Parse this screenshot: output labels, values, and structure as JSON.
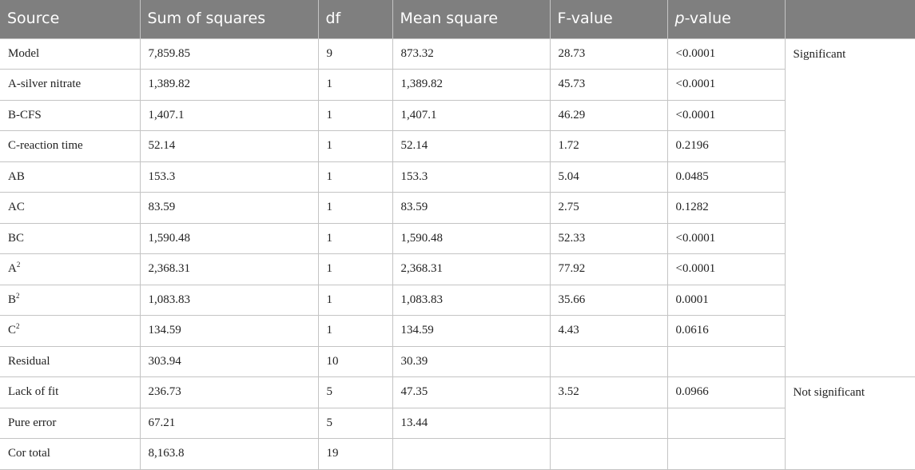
{
  "table": {
    "headers": {
      "source": "Source",
      "sum_of_squares": "Sum of squares",
      "df": "df",
      "mean_square": "Mean square",
      "f_value": "F-value",
      "p_prefix": "p",
      "p_suffix": "-value",
      "significance": ""
    },
    "rows": [
      {
        "source": "Model",
        "sup": "",
        "ss": "7,859.85",
        "df": "9",
        "ms": "873.32",
        "f": "28.73",
        "p": "<0.0001"
      },
      {
        "source": "A-silver nitrate",
        "sup": "",
        "ss": "1,389.82",
        "df": "1",
        "ms": "1,389.82",
        "f": "45.73",
        "p": "<0.0001"
      },
      {
        "source": "B-CFS",
        "sup": "",
        "ss": "1,407.1",
        "df": "1",
        "ms": "1,407.1",
        "f": "46.29",
        "p": "<0.0001"
      },
      {
        "source": "C-reaction time",
        "sup": "",
        "ss": "52.14",
        "df": "1",
        "ms": "52.14",
        "f": "1.72",
        "p": "0.2196"
      },
      {
        "source": "AB",
        "sup": "",
        "ss": "153.3",
        "df": "1",
        "ms": "153.3",
        "f": "5.04",
        "p": "0.0485"
      },
      {
        "source": "AC",
        "sup": "",
        "ss": "83.59",
        "df": "1",
        "ms": "83.59",
        "f": "2.75",
        "p": "0.1282"
      },
      {
        "source": "BC",
        "sup": "",
        "ss": "1,590.48",
        "df": "1",
        "ms": "1,590.48",
        "f": "52.33",
        "p": "<0.0001"
      },
      {
        "source": "A",
        "sup": "2",
        "ss": "2,368.31",
        "df": "1",
        "ms": "2,368.31",
        "f": "77.92",
        "p": "<0.0001"
      },
      {
        "source": "B",
        "sup": "2",
        "ss": "1,083.83",
        "df": "1",
        "ms": "1,083.83",
        "f": "35.66",
        "p": "0.0001"
      },
      {
        "source": "C",
        "sup": "2",
        "ss": "134.59",
        "df": "1",
        "ms": "134.59",
        "f": "4.43",
        "p": "0.0616"
      },
      {
        "source": "Residual",
        "sup": "",
        "ss": "303.94",
        "df": "10",
        "ms": "30.39",
        "f": "",
        "p": ""
      },
      {
        "source": "Lack of fit",
        "sup": "",
        "ss": "236.73",
        "df": "5",
        "ms": "47.35",
        "f": "3.52",
        "p": "0.0966"
      },
      {
        "source": "Pure error",
        "sup": "",
        "ss": "67.21",
        "df": "5",
        "ms": "13.44",
        "f": "",
        "p": ""
      },
      {
        "source": "Cor total",
        "sup": "",
        "ss": "8,163.8",
        "df": "19",
        "ms": "",
        "f": "",
        "p": ""
      }
    ],
    "notes": {
      "model": "Significant",
      "lack_of_fit": "Not significant"
    }
  }
}
